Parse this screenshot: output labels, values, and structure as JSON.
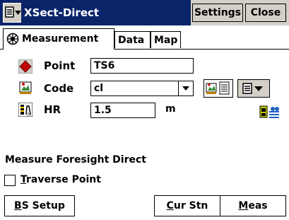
{
  "window": {
    "title": "XSect-Direct",
    "settings_label": "Settings",
    "close_label": "Close"
  },
  "tabs": [
    {
      "label": "Measurement"
    },
    {
      "label": "Data"
    },
    {
      "label": "Map"
    }
  ],
  "form": {
    "point": {
      "label": "Point",
      "value": "TS6"
    },
    "code": {
      "label": "Code",
      "value": "cl"
    },
    "hr": {
      "label": "HR",
      "value": "1.5",
      "unit": "m"
    }
  },
  "status_text": "Measure Foresight Direct",
  "traverse": {
    "underlined_letter": "T",
    "rest": "raverse Point",
    "checked": false
  },
  "buttons": {
    "bs_setup": {
      "u": "B",
      "rest": "S Setup"
    },
    "cur_stn": {
      "u": "C",
      "rest": "ur Stn"
    },
    "meas": {
      "u": "M",
      "rest": "eas"
    }
  },
  "icons": [
    "menu-icon",
    "globe-icon",
    "point-diamond-icon",
    "code-icon",
    "code-list-icon",
    "hr-icon",
    "instrument-icon"
  ]
}
